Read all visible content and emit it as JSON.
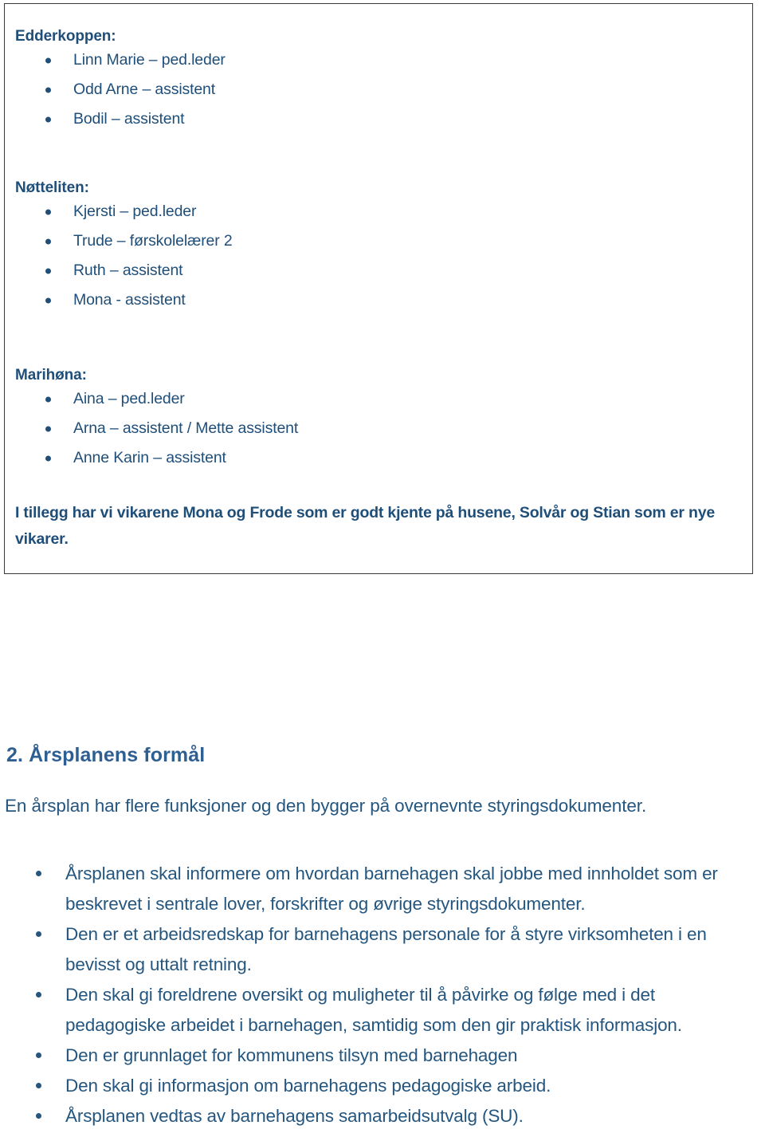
{
  "document": {
    "theme_color": "#1f4e79",
    "body_color": "#24567f",
    "heading_color": "#2e5f92",
    "background": "#ffffff"
  },
  "staff_box": {
    "departments": [
      {
        "title": "Edderkoppen:",
        "members": [
          "Linn Marie – ped.leder",
          "Odd Arne – assistent",
          "Bodil – assistent"
        ]
      },
      {
        "title": "Nøtteliten:",
        "members": [
          "Kjersti – ped.leder",
          "Trude – førskolelærer 2",
          "Ruth – assistent",
          "Mona - assistent"
        ]
      },
      {
        "title": "Marihøna:",
        "members": [
          "Aina – ped.leder",
          "Arna – assistent / Mette assistent",
          "Anne Karin – assistent"
        ]
      }
    ],
    "note": "I tillegg har vi vikarene Mona og Frode som er godt kjente på husene, Solvår og Stian som er nye vikarer."
  },
  "section": {
    "heading": "2. Årsplanens formål",
    "intro": "En årsplan har flere funksjoner og den bygger på overnevnte styringsdokumenter.",
    "purposes": [
      "Årsplanen skal informere om hvordan barnehagen skal jobbe med innholdet som er beskrevet i sentrale lover, forskrifter og øvrige styringsdokumenter.",
      "Den er et arbeidsredskap for barnehagens personale for å styre virksomheten i en bevisst og uttalt retning.",
      "Den skal gi foreldrene oversikt og muligheter til å påvirke og følge med i det pedagogiske arbeidet i barnehagen, samtidig som den gir praktisk informasjon.",
      "Den er grunnlaget for kommunens tilsyn med barnehagen",
      "Den skal gi informasjon om barnehagens pedagogiske arbeid.",
      "Årsplanen vedtas av barnehagens samarbeidsutvalg (SU)."
    ]
  }
}
